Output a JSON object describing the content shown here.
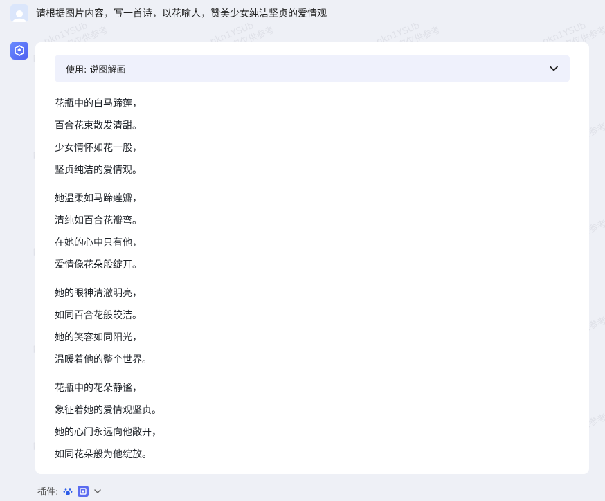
{
  "user": {
    "message": "请根据图片内容，写一首诗，以花喻人，赞美少女纯洁坚贞的爱情观"
  },
  "response": {
    "plugin_used": "使用: 说图解画",
    "stanzas": [
      [
        "花瓶中的白马蹄莲，",
        "百合花束散发清甜。",
        "少女情怀如花一般，",
        "坚贞纯洁的爱情观。"
      ],
      [
        "她温柔如马蹄莲瓣，",
        "清纯如百合花瓣弯。",
        "在她的心中只有他，",
        "爱情像花朵般绽开。"
      ],
      [
        "她的眼神清澈明亮，",
        "如同百合花般皎洁。",
        "她的笑容如同阳光，",
        "温暖着他的整个世界。"
      ],
      [
        "花瓶中的花朵静谧，",
        "象征着她的爱情观坚贞。",
        "她的心门永远向他敞开，",
        "如同花朵般为他绽放。"
      ]
    ]
  },
  "footer": {
    "plugins_label": "插件:",
    "icons": [
      "paw-icon",
      "plugin-icon",
      "chevron-down-icon"
    ]
  },
  "watermark": {
    "line1": "pkn1YSUb",
    "line2": "AI生成内容仅供参考"
  },
  "colors": {
    "background": "#eef0f6",
    "card": "#ffffff",
    "plugin_bar": "#eff1fc",
    "accent": "#4f5ff0"
  }
}
